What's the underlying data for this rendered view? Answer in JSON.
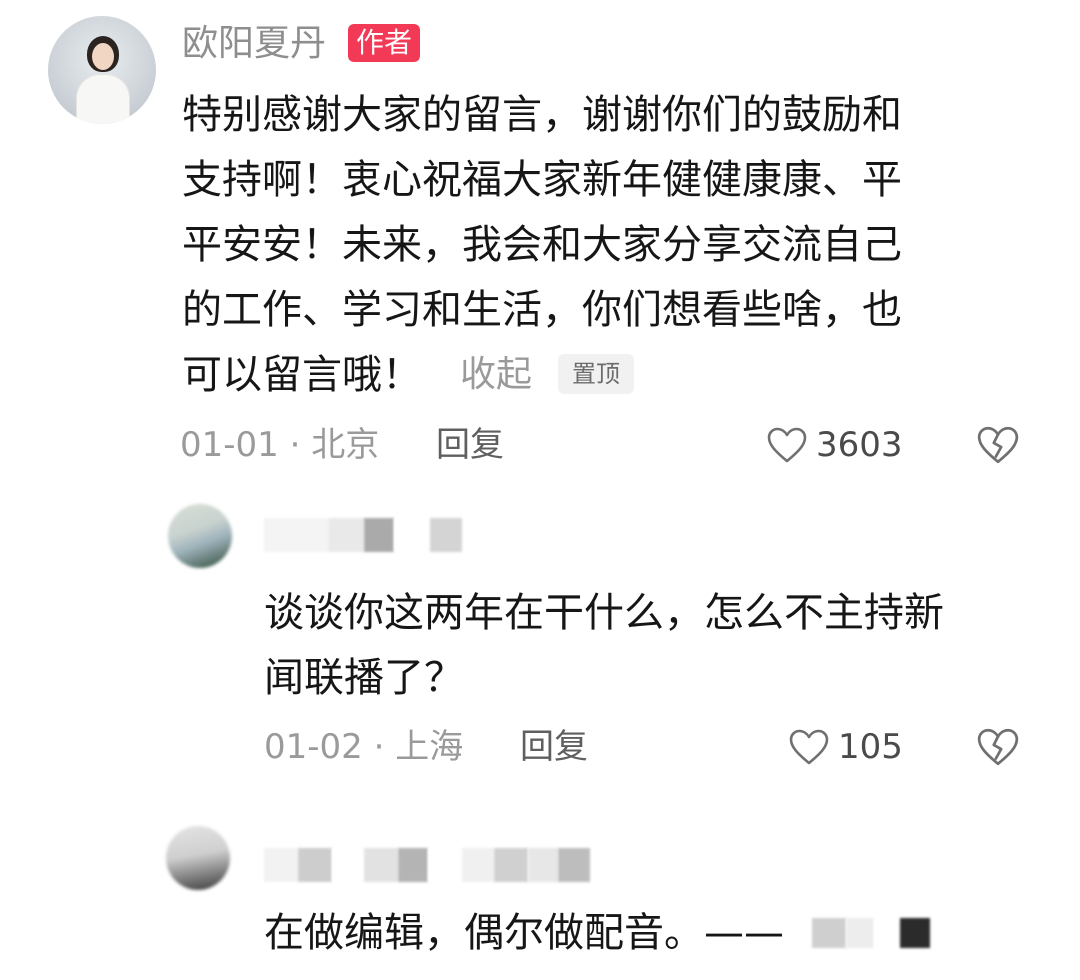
{
  "author_comment": {
    "name": "欧阳夏丹",
    "badge": "作者",
    "lines": [
      "特别感谢大家的留言，谢谢你们的鼓励和",
      "支持啊！衷心祝福大家新年健健康康、平",
      "平安安！未来，我会和大家分享交流自己",
      "的工作、学习和生活，你们想看些啥，也",
      "可以留言哦！"
    ],
    "collapse_label": "收起",
    "pin_label": "置顶",
    "meta": "01-01 · 北京",
    "reply_label": "回复",
    "like_count": "3603"
  },
  "replies": [
    {
      "lines": [
        "谈谈你这两年在干什么，怎么不主持新",
        "闻联播了？"
      ],
      "meta": "01-02 · 上海",
      "reply_label": "回复",
      "like_count": "105"
    },
    {
      "lines": [
        "在做编辑，偶尔做配音。——"
      ]
    }
  ],
  "colors": {
    "badge_red": "#f23a57",
    "name_gray": "#8e8e8e",
    "meta_gray": "#9a9a9a",
    "text": "#161616"
  },
  "icons": {
    "like": "heart-outline-icon",
    "dislike": "broken-heart-icon"
  }
}
